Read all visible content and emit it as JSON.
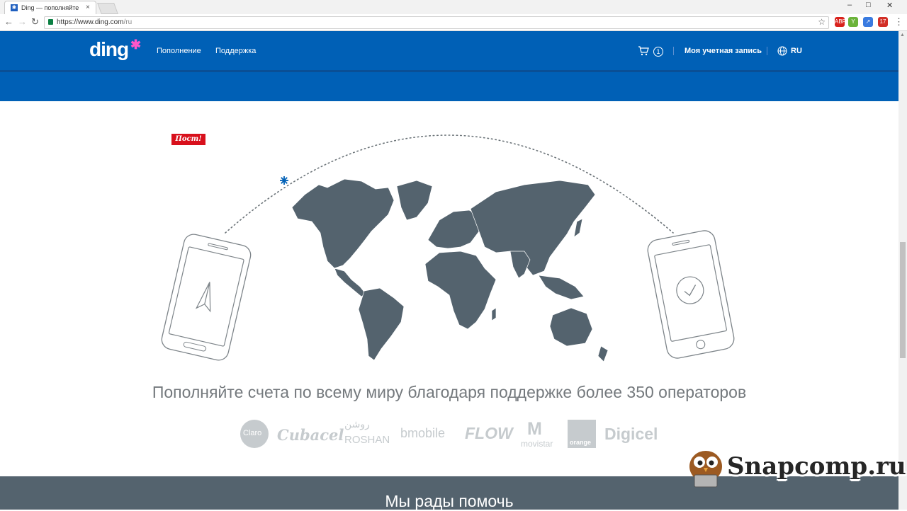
{
  "browser": {
    "tab_title": "Ding — пополняйте сче",
    "favicon": "✱",
    "url_host": "https://www.ding.com",
    "url_path": "/ru",
    "tab_close": "×",
    "minimize": "–",
    "maximize": "□",
    "close": "✕",
    "extensions": [
      {
        "name": "adblock-plus-icon",
        "label": "ABP",
        "color": "#d9221c"
      },
      {
        "name": "yoroi-extension-icon",
        "label": "Y",
        "color": "#6bb33a"
      },
      {
        "name": "analytics-extension-icon",
        "label": "↗",
        "color": "#3a7be0"
      },
      {
        "name": "tabs-extension-icon",
        "label": "17",
        "color": "#d22f27"
      }
    ]
  },
  "header": {
    "logo": "ding",
    "logo_star": "✱",
    "nav": [
      "Пополнение",
      "Поддержка"
    ],
    "cart_count": "1",
    "account": "Моя учетная запись",
    "language": "RU"
  },
  "hero": {
    "badge": "Пост!",
    "tagline": "Пополняйте счета по всему миру благодаря поддержке более 350 операторов"
  },
  "operators": [
    "Claro",
    "Cubacel",
    "روشن",
    "ROSHAN",
    "bmobile",
    "FLOW",
    "movistar",
    "orange",
    "Digicel"
  ],
  "footer": {
    "title": "Мы рады помочь"
  },
  "watermark": {
    "text": "Snapcomp.ru"
  },
  "colors": {
    "brand_blue": "#0060b6",
    "brand_pink": "#ff56c9",
    "map_gray": "#54636e",
    "badge_red": "#d8101c"
  }
}
